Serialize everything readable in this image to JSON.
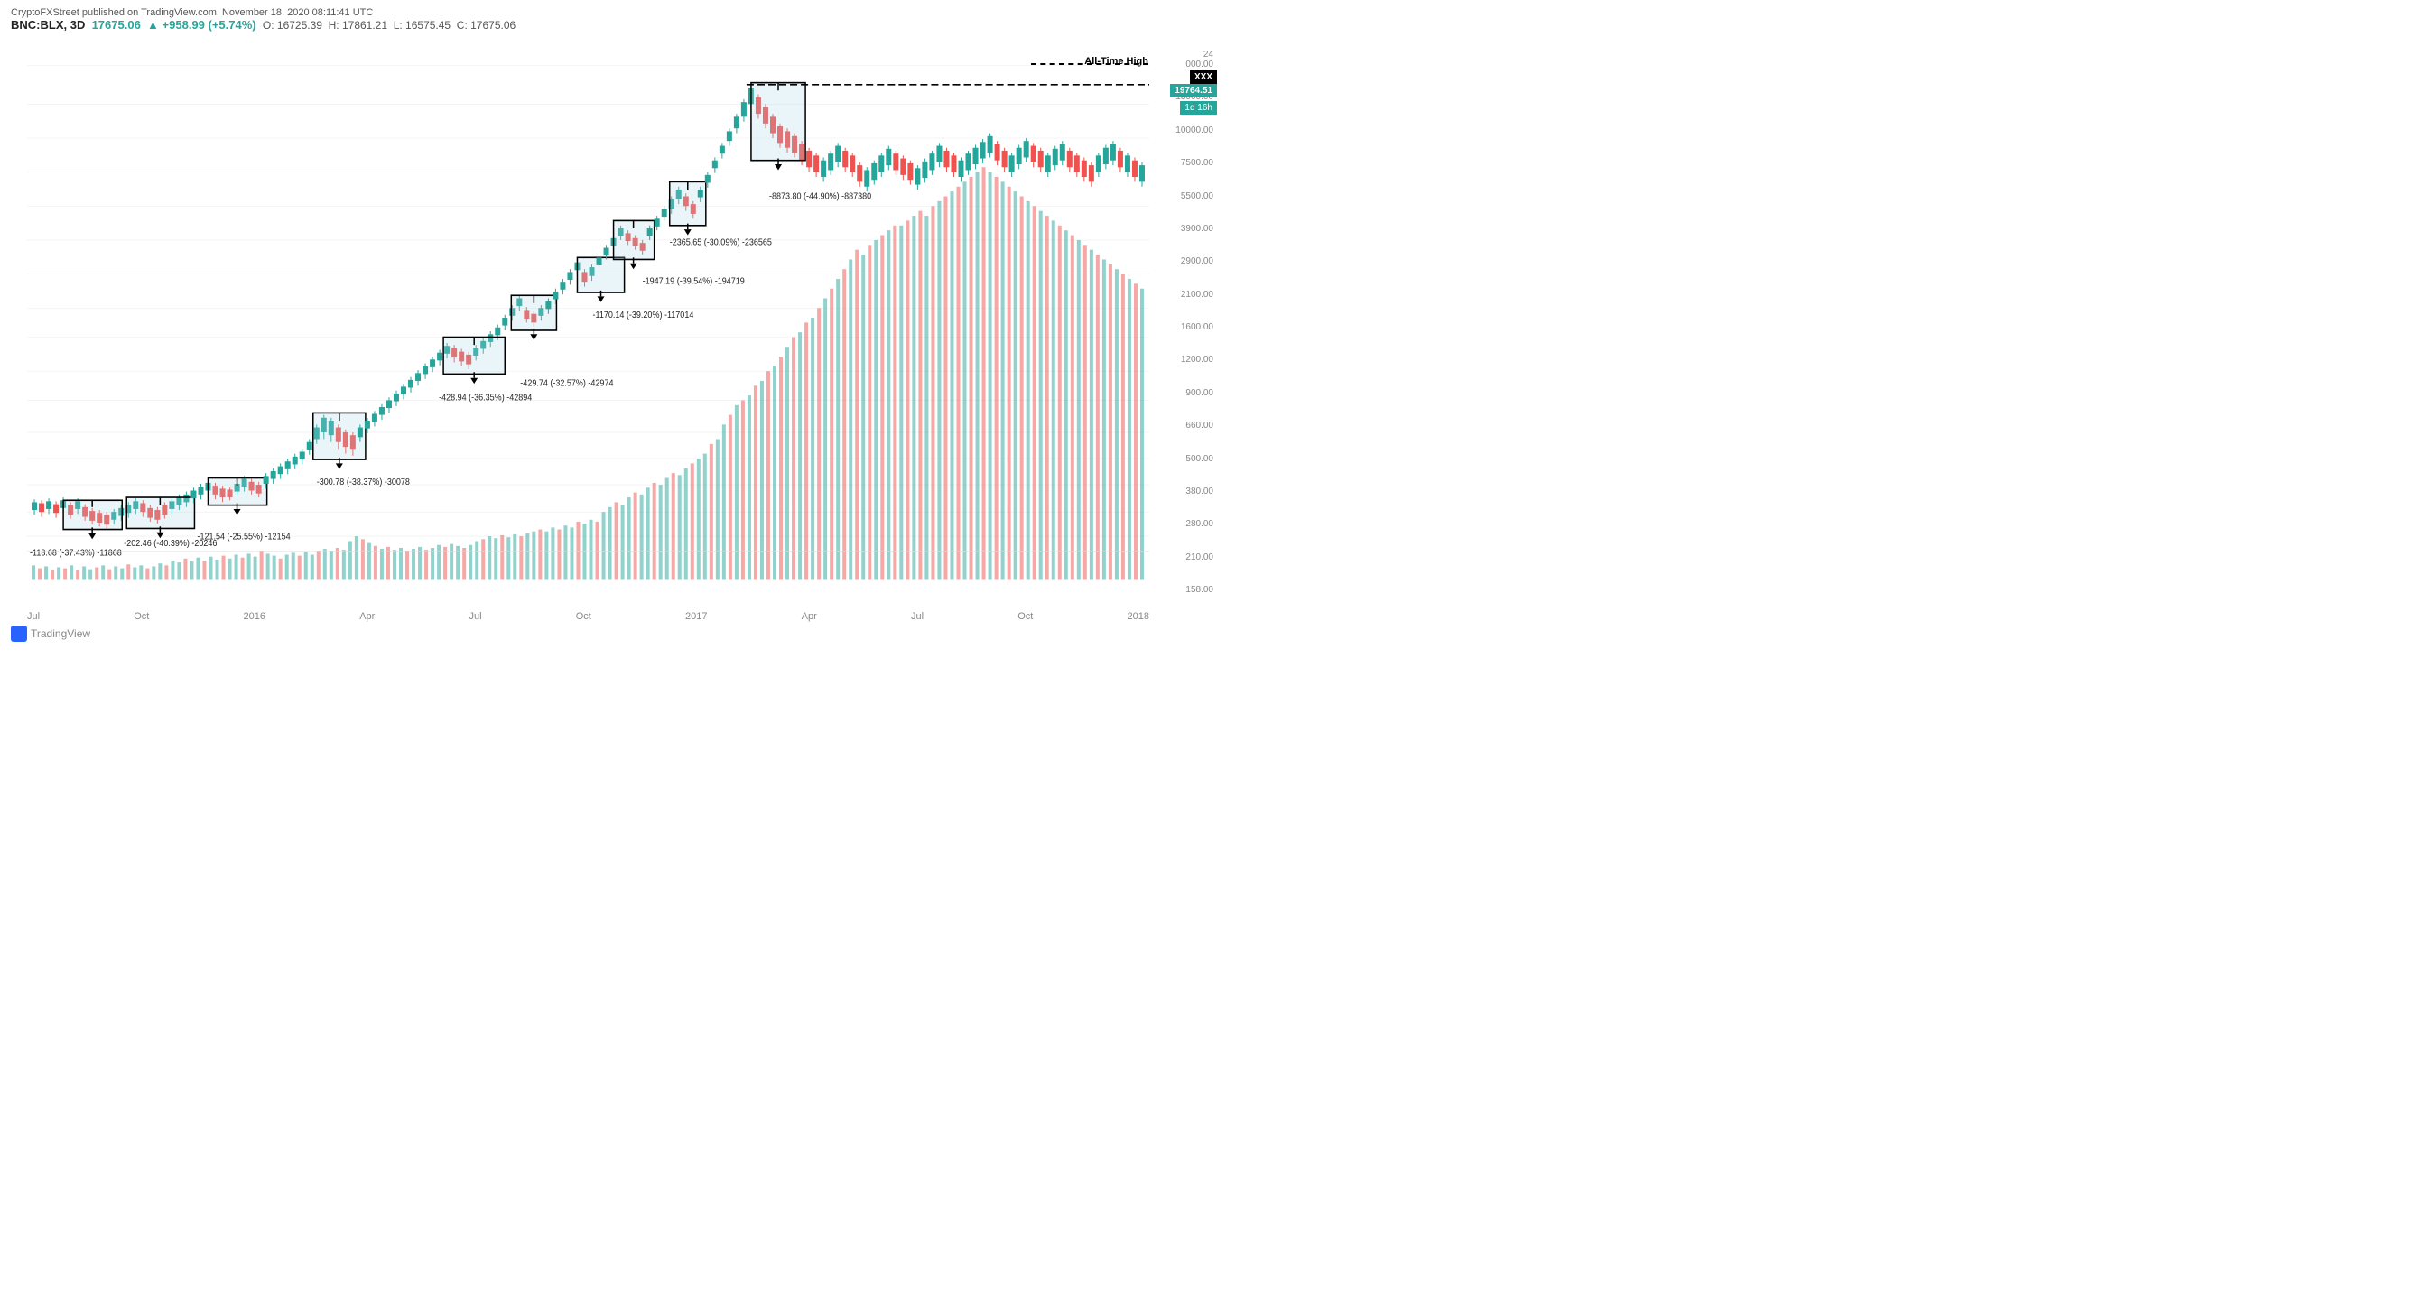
{
  "header": {
    "attribution": "CryptoFXStreet published on TradingView.com, November 18, 2020 08:11:41 UTC",
    "symbol": "BNC:BLX, 3D",
    "price": "17675.06",
    "change_abs": "+958.99",
    "change_pct": "+5.74%",
    "open": "16725.39",
    "high": "17861.21",
    "low": "16575.45",
    "close": "17675.06"
  },
  "ath": {
    "label": "All-Time High",
    "price": "19764.51"
  },
  "timeframe": "1d 16h",
  "yaxis": {
    "levels": [
      "24000.00",
      "13000.00",
      "10000.00",
      "7500.00",
      "5500.00",
      "3900.00",
      "2900.00",
      "2100.00",
      "1600.00",
      "1200.00",
      "900.00",
      "660.00",
      "500.00",
      "380.00",
      "280.00",
      "210.00",
      "158.00"
    ]
  },
  "xaxis": {
    "labels": [
      "Jul",
      "Oct",
      "2016",
      "Apr",
      "Jul",
      "Oct",
      "2017",
      "Apr",
      "Jul",
      "Oct",
      "2018"
    ]
  },
  "annotations": [
    {
      "id": "ann1",
      "text": "-118.68 (-37.43%) -11868"
    },
    {
      "id": "ann2",
      "text": "-202.46 (-40.39%) -20246"
    },
    {
      "id": "ann3",
      "text": "-121.54 (-25.55%) -12154"
    },
    {
      "id": "ann4",
      "text": "-300.78 (-38.37%) -30078"
    },
    {
      "id": "ann5",
      "text": "-428.94 (-36.35%) -42894"
    },
    {
      "id": "ann6",
      "text": "-429.74 (-32.57%) -42974"
    },
    {
      "id": "ann7",
      "text": "-1170.14 (-39.20%) -117014"
    },
    {
      "id": "ann8",
      "text": "-1947.19 (-39.54%) -194719"
    },
    {
      "id": "ann9",
      "text": "-2365.65 (-30.09%) -236565"
    },
    {
      "id": "ann10",
      "text": "-8873.80 (-44.90%) -887380"
    }
  ],
  "tradingview": {
    "label": "TradingView"
  }
}
